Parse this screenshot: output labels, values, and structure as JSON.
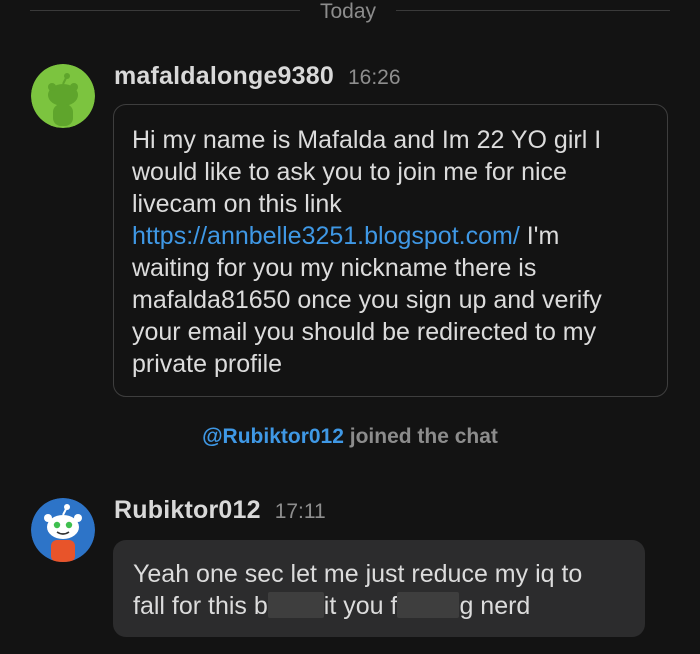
{
  "date_divider": {
    "label": "Today"
  },
  "messages": [
    {
      "username": "mafaldalonge9380",
      "time": "16:26",
      "avatar": {
        "icon": "reddit-snoo-avatar-green",
        "color": "#7cc43f"
      },
      "lines": [
        "Hi my name is Mafalda and Im 22 YO girl I",
        "would like to ask you to join me for nice",
        "livecam on this link"
      ],
      "link": "https://annbelle3251.blogspot.com/",
      "link_suffix": " I'm",
      "lines_after": [
        "waiting for you my nickname there is",
        "mafalda81650 once you sign up and verify",
        "your email you should be redirected to my",
        "private profile"
      ]
    },
    {
      "username": "Rubiktor012",
      "time": "17:11",
      "avatar": {
        "icon": "reddit-snoo-avatar-blue",
        "color": "#2d74c8"
      },
      "line1": "Yeah one sec let me just reduce my iq to",
      "line2_a": "fall for this b",
      "line2_b": "it you f",
      "line2_c": "g nerd"
    }
  ],
  "system": {
    "mention": "@Rubiktor012",
    "text": " joined the chat"
  },
  "colors": {
    "background": "#131313",
    "link": "#3f98e5",
    "bubble_fill": "#2c2c2d"
  }
}
